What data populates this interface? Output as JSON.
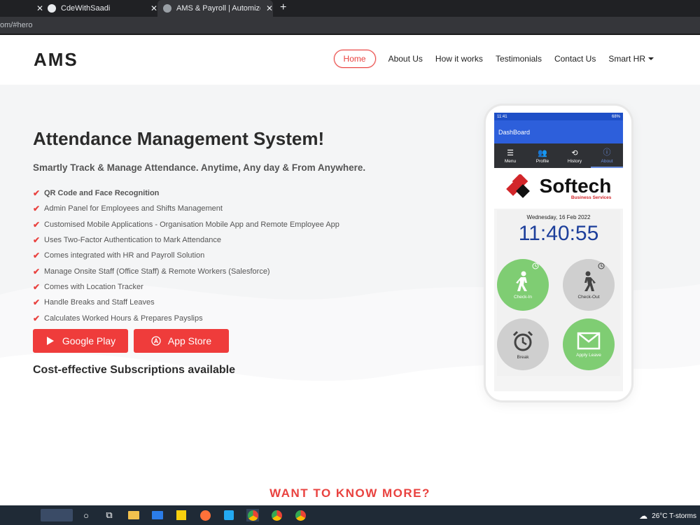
{
  "browser": {
    "tabs": [
      {
        "title": "CdeWithSaadi"
      },
      {
        "title": "AMS & Payroll | Automized atten"
      }
    ],
    "url": "om/#hero"
  },
  "header": {
    "logo": "AMS",
    "nav": [
      {
        "label": "Home",
        "active": true
      },
      {
        "label": "About Us"
      },
      {
        "label": "How it works"
      },
      {
        "label": "Testimonials"
      },
      {
        "label": "Contact Us"
      },
      {
        "label": "Smart HR"
      }
    ]
  },
  "hero": {
    "title": "Attendance Management System!",
    "subtitle": "Smartly Track & Manage Attendance. Anytime, Any day & From Anywhere.",
    "features": [
      "QR Code and Face Recognition",
      "Admin Panel for Employees and Shifts Management",
      "Customised Mobile Applications - Organisation Mobile App and Remote Employee App",
      "Uses Two-Factor Authentication to Mark Attendance",
      "Comes integrated with HR and Payroll Solution",
      "Manage Onsite Staff (Office Staff) & Remote Workers (Salesforce)",
      "Comes with Location Tracker",
      "Handle Breaks and Staff Leaves",
      "Calculates Worked Hours & Prepares Payslips"
    ],
    "buttons": {
      "google_play": "Google Play",
      "app_store": "App Store"
    },
    "cost": "Cost-effective Subscriptions available"
  },
  "phone": {
    "status_time": "11:41",
    "status_right": "68%",
    "appbar": "DashBoard",
    "tabs": [
      "Menu",
      "Profile",
      "History",
      "About"
    ],
    "brand": {
      "name": "Softech",
      "tagline": "Business Services"
    },
    "date": "Wednesday, 16 Feb 2022",
    "time": "11:40:55",
    "actions": [
      "Check-In",
      "Check-Out",
      "Break",
      "Apply Leave"
    ]
  },
  "more_heading": "WANT TO KNOW MORE?",
  "taskbar": {
    "weather": "26°C  T-storms"
  },
  "colors": {
    "accent": "#e9423f",
    "app_blue": "#2d5fdb",
    "time_blue": "#1d3f9b",
    "green": "#7fcd73"
  }
}
